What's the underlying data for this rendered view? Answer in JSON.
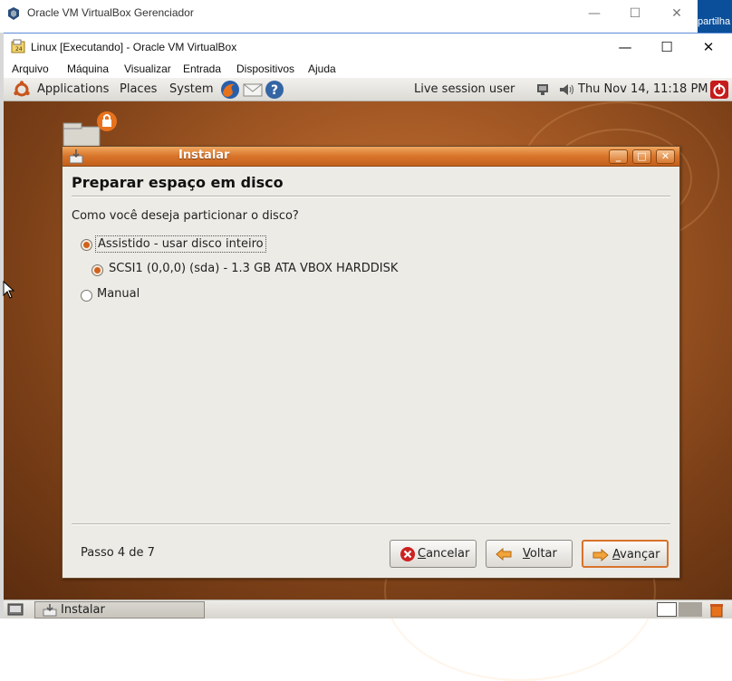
{
  "host_window": {
    "title": "Oracle VM VirtualBox Gerenciador",
    "minimize": "—",
    "maximize": "☐",
    "close": "✕",
    "right_edge_text": "partilha"
  },
  "vm_window": {
    "title": "Linux [Executando] - Oracle VM VirtualBox",
    "minimize": "—",
    "maximize": "☐",
    "close": "✕",
    "menu": [
      "Arquivo",
      "Máquina",
      "Visualizar",
      "Entrada",
      "Dispositivos",
      "Ajuda"
    ]
  },
  "top_panel": {
    "menus": [
      "Applications",
      "Places",
      "System"
    ],
    "user": "Live session user",
    "datetime": "Thu Nov 14, 11:18 PM"
  },
  "dialog": {
    "title": "Instalar",
    "heading": "Preparar espaço em disco",
    "question": "Como você deseja particionar o disco?",
    "options": [
      {
        "label": "Assistido - usar disco inteiro",
        "selected": true
      },
      {
        "label": "SCSI1 (0,0,0) (sda) - 1.3 GB ATA VBOX HARDDISK",
        "selected": true
      },
      {
        "label": "Manual",
        "selected": false
      }
    ],
    "step": "Passo 4 de 7",
    "buttons": {
      "cancel_mn": "C",
      "cancel_rest": "ancelar",
      "back_mn": "V",
      "back_rest": "oltar",
      "forward_mn": "A",
      "forward_rest": "vançar"
    }
  },
  "taskbar": {
    "task": "Instalar"
  },
  "colors": {
    "accent": "#d8742a",
    "desktop": "#a65a25",
    "host_blue": "#0b4f9a"
  }
}
